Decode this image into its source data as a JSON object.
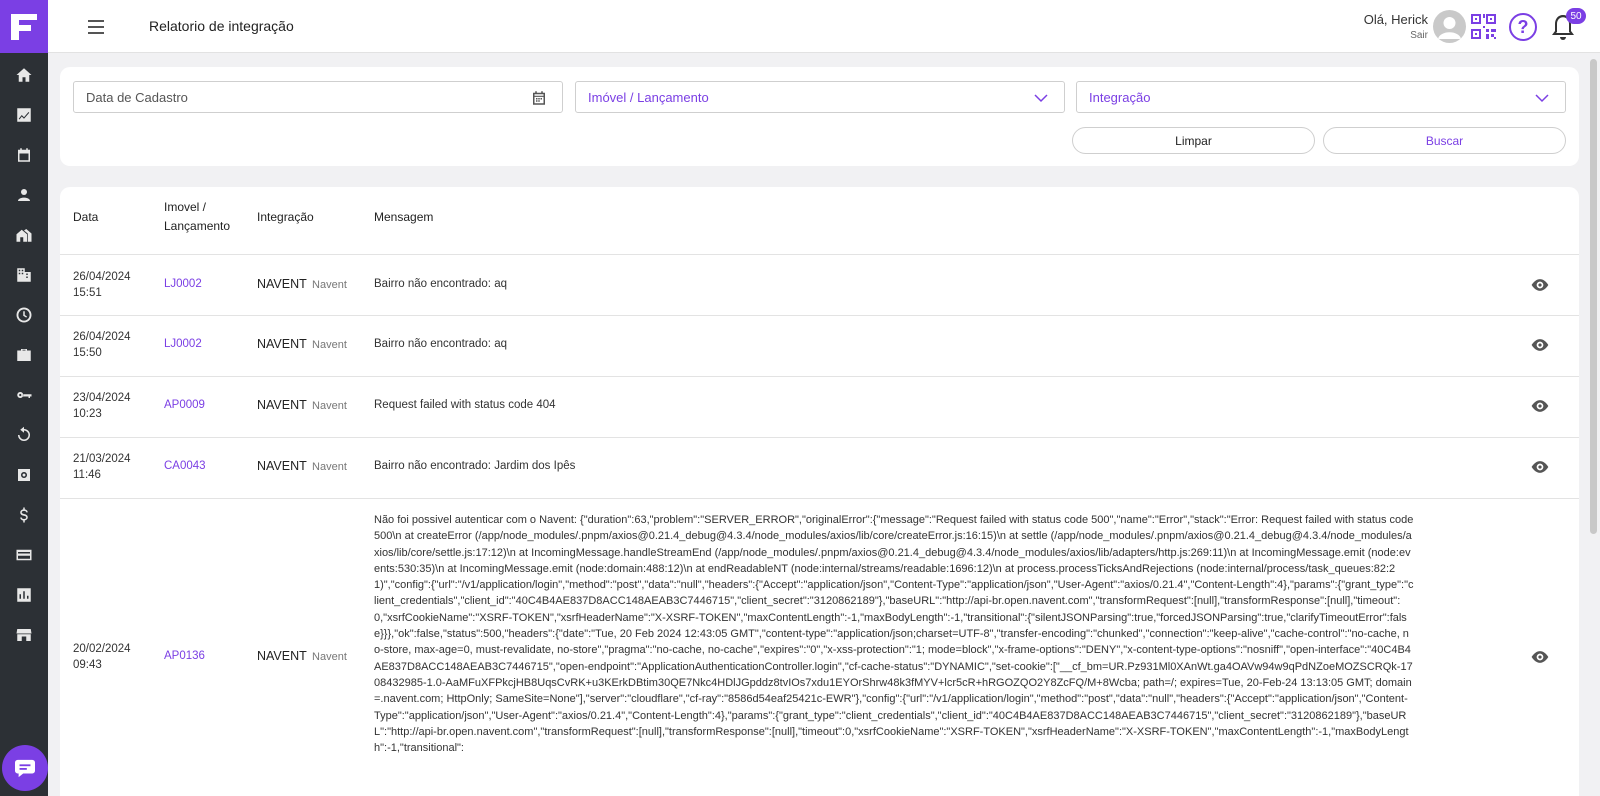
{
  "header": {
    "title": "Relatorio de integração",
    "greeting": "Olá, Herick",
    "logout": "Sair",
    "notifications": "50"
  },
  "filters": {
    "date_placeholder": "Data de Cadastro",
    "imovel_placeholder": "Imóvel / Lançamento",
    "integracao_placeholder": "Integração",
    "clear_label": "Limpar",
    "search_label": "Buscar"
  },
  "table": {
    "headers": {
      "date": "Data",
      "imovel_1": "Imovel /",
      "imovel_2": "Lançamento",
      "integracao": "Integração",
      "mensagem": "Mensagem"
    },
    "rows": [
      {
        "date": "26/04/2024",
        "time": "15:51",
        "code": "LJ0002",
        "integ": "NAVENT",
        "integ_sub": "Navent",
        "msg": "Bairro não encontrado: aq"
      },
      {
        "date": "26/04/2024",
        "time": "15:50",
        "code": "LJ0002",
        "integ": "NAVENT",
        "integ_sub": "Navent",
        "msg": "Bairro não encontrado: aq"
      },
      {
        "date": "23/04/2024",
        "time": "10:23",
        "code": "AP0009",
        "integ": "NAVENT",
        "integ_sub": "Navent",
        "msg": "Request failed with status code 404"
      },
      {
        "date": "21/03/2024",
        "time": "11:46",
        "code": "CA0043",
        "integ": "NAVENT",
        "integ_sub": "Navent",
        "msg": "Bairro não encontrado: Jardim dos Ipês"
      },
      {
        "date": "20/02/2024",
        "time": "09:43",
        "code": "AP0136",
        "integ": "NAVENT",
        "integ_sub": "Navent",
        "msg": "Não foi possivel autenticar com o Navent: {\"duration\":63,\"problem\":\"SERVER_ERROR\",\"originalError\":{\"message\":\"Request failed with status code 500\",\"name\":\"Error\",\"stack\":\"Error: Request failed with status code 500\\n at createError (/app/node_modules/.pnpm/axios@0.21.4_debug@4.3.4/node_modules/axios/lib/core/createError.js:16:15)\\n at settle (/app/node_modules/.pnpm/axios@0.21.4_debug@4.3.4/node_modules/axios/lib/core/settle.js:17:12)\\n at IncomingMessage.handleStreamEnd (/app/node_modules/.pnpm/axios@0.21.4_debug@4.3.4/node_modules/axios/lib/adapters/http.js:269:11)\\n at IncomingMessage.emit (node:events:530:35)\\n at IncomingMessage.emit (node:domain:488:12)\\n at endReadableNT (node:internal/streams/readable:1696:12)\\n at process.processTicksAndRejections (node:internal/process/task_queues:82:21)\",\"config\":{\"url\":\"/v1/application/login\",\"method\":\"post\",\"data\":\"null\",\"headers\":{\"Accept\":\"application/json\",\"Content-Type\":\"application/json\",\"User-Agent\":\"axios/0.21.4\",\"Content-Length\":4},\"params\":{\"grant_type\":\"client_credentials\",\"client_id\":\"40C4B4AE837D8ACC148AEAB3C7446715\",\"client_secret\":\"3120862189\"},\"baseURL\":\"http://api-br.open.navent.com\",\"transformRequest\":[null],\"transformResponse\":[null],\"timeout\":0,\"xsrfCookieName\":\"XSRF-TOKEN\",\"xsrfHeaderName\":\"X-XSRF-TOKEN\",\"maxContentLength\":-1,\"maxBodyLength\":-1,\"transitional\":{\"silentJSONParsing\":true,\"forcedJSONParsing\":true,\"clarifyTimeoutError\":false}}},\"ok\":false,\"status\":500,\"headers\":{\"date\":\"Tue, 20 Feb 2024 12:43:05 GMT\",\"content-type\":\"application/json;charset=UTF-8\",\"transfer-encoding\":\"chunked\",\"connection\":\"keep-alive\",\"cache-control\":\"no-cache, no-store, max-age=0, must-revalidate, no-store\",\"pragma\":\"no-cache, no-cache\",\"expires\":\"0\",\"x-xss-protection\":\"1; mode=block\",\"x-frame-options\":\"DENY\",\"x-content-type-options\":\"nosniff\",\"open-interface\":\"40C4B4AE837D8ACC148AEAB3C7446715\",\"open-endpoint\":\"ApplicationAuthenticationController.login\",\"cf-cache-status\":\"DYNAMIC\",\"set-cookie\":[\"__cf_bm=UR.Pz931Ml0XAnWt.ga4OAVw94w9qPdNZoeMOZSCRQk-1708432985-1.0-AaMFuXFPkcjHB8UqsCvRK+u3KErkDBtim30QE7Nkc4HDlJGpddz8tvIOs7xdu1EYOrShrw48k3fMYV+lcr5cR+hRGOZQO2Y8ZcFQ/M+8Wcba; path=/; expires=Tue, 20-Feb-24 13:13:05 GMT; domain=.navent.com; HttpOnly; SameSite=None\"],\"server\":\"cloudflare\",\"cf-ray\":\"8586d54eaf25421c-EWR\"},\"config\":{\"url\":\"/v1/application/login\",\"method\":\"post\",\"data\":\"null\",\"headers\":{\"Accept\":\"application/json\",\"Content-Type\":\"application/json\",\"User-Agent\":\"axios/0.21.4\",\"Content-Length\":4},\"params\":{\"grant_type\":\"client_credentials\",\"client_id\":\"40C4B4AE837D8ACC148AEAB3C7446715\",\"client_secret\":\"3120862189\"},\"baseURL\":\"http://api-br.open.navent.com\",\"transformRequest\":[null],\"transformResponse\":[null],\"timeout\":0,\"xsrfCookieName\":\"XSRF-TOKEN\",\"xsrfHeaderName\":\"X-XSRF-TOKEN\",\"maxContentLength\":-1,\"maxBodyLength\":-1,\"transitional\":"
      }
    ]
  },
  "icons": {
    "sidebar": [
      "home-icon",
      "chart-icon",
      "calendar-icon",
      "user-icon",
      "house-icon",
      "building-icon",
      "clock-icon",
      "briefcase-icon",
      "key-icon",
      "refresh-icon",
      "settings-icon",
      "dollar-icon",
      "card-icon",
      "report-icon",
      "store-icon"
    ],
    "accent": "#7b3fe4"
  }
}
